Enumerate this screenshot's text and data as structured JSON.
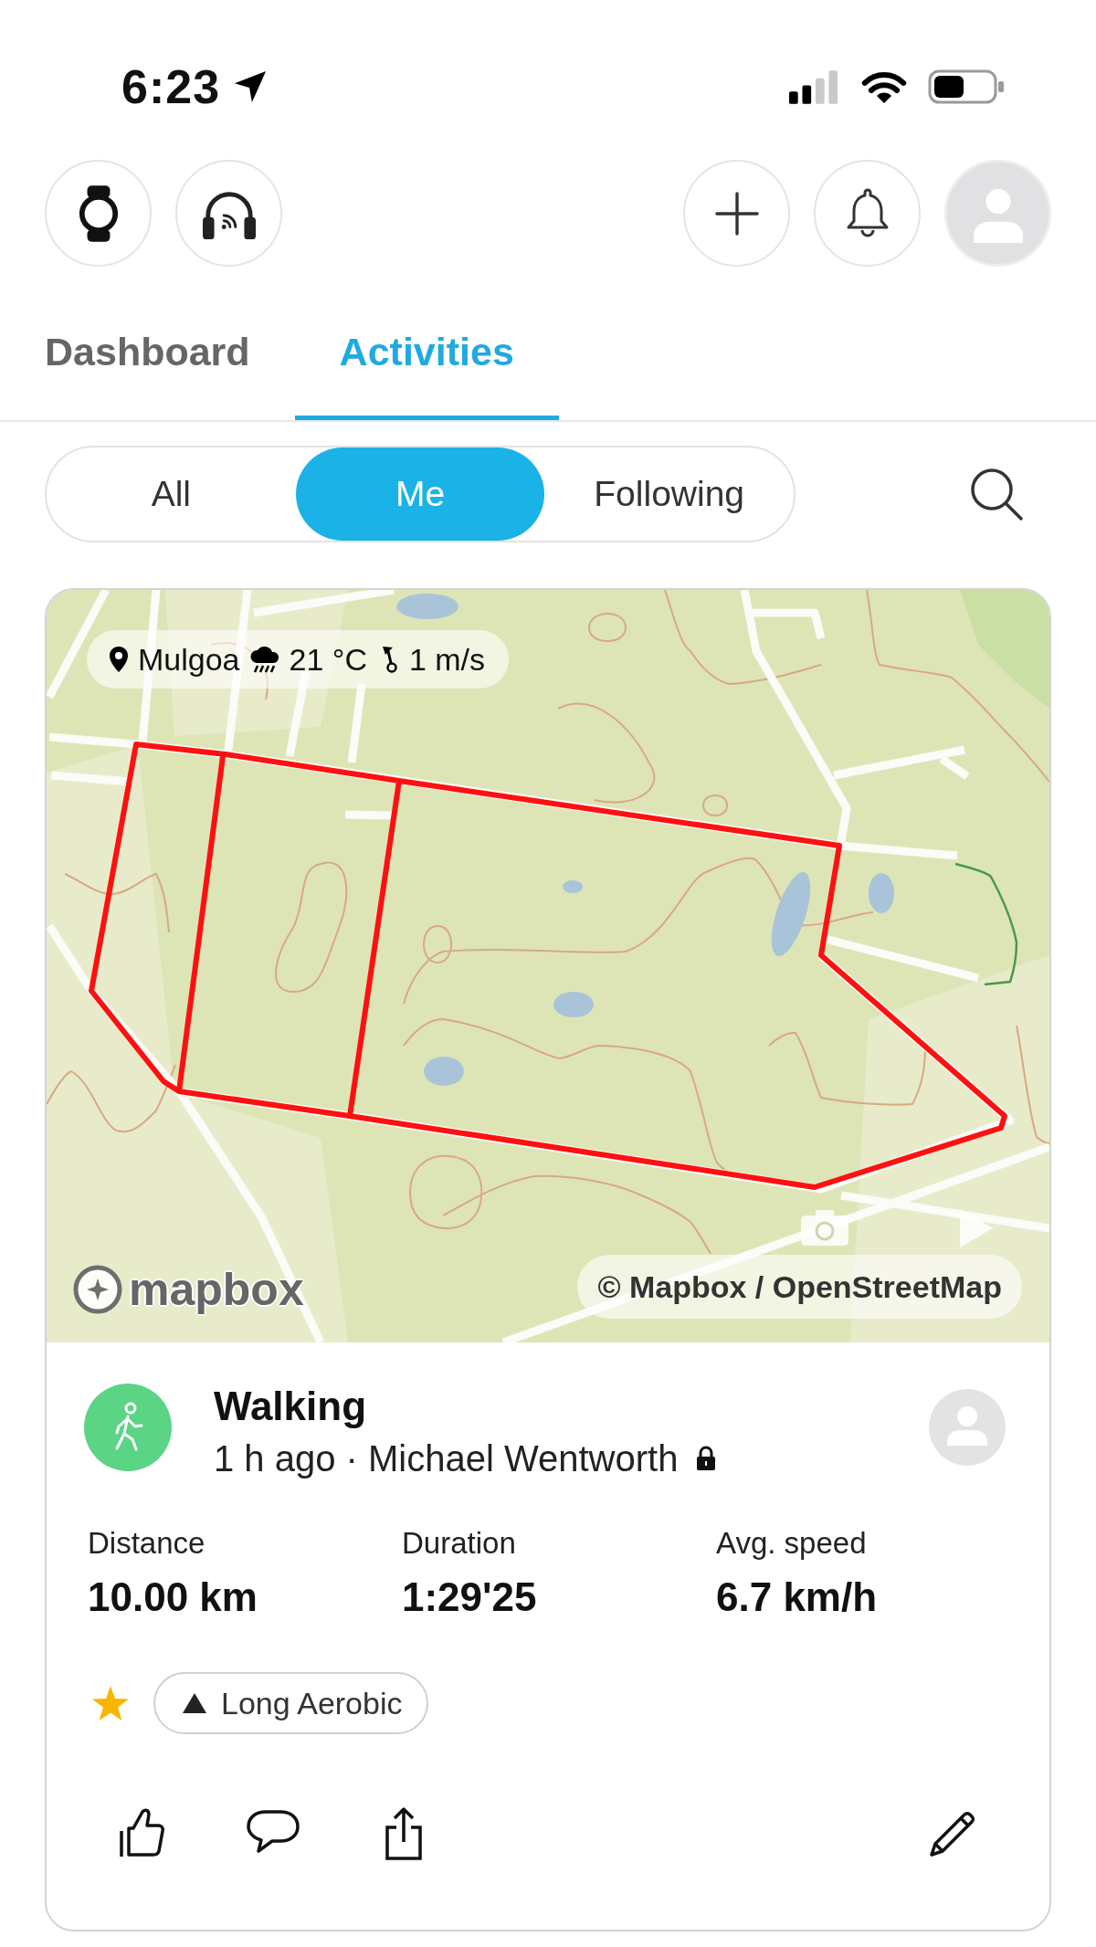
{
  "status_bar": {
    "time": "6:23"
  },
  "tabs": [
    {
      "label": "Dashboard",
      "selected": false
    },
    {
      "label": "Activities",
      "selected": true
    }
  ],
  "filters": [
    {
      "label": "All",
      "selected": false
    },
    {
      "label": "Me",
      "selected": true
    },
    {
      "label": "Following",
      "selected": false
    }
  ],
  "activity": {
    "map": {
      "location": "Mulgoa",
      "temperature": "21 °C",
      "wind": "1 m/s",
      "logo": "mapbox",
      "attribution": "© Mapbox / OpenStreetMap"
    },
    "title": "Walking",
    "subtitle": "1 h ago · Michael Wentworth",
    "private": true,
    "stats": [
      {
        "label": "Distance",
        "value": "10.00 km"
      },
      {
        "label": "Duration",
        "value": "1:29'25"
      },
      {
        "label": "Avg. speed",
        "value": "6.7 km/h"
      }
    ],
    "starred": true,
    "tag": "Long Aerobic"
  }
}
